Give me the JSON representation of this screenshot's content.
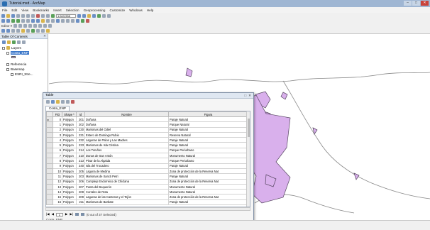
{
  "window": {
    "title": "Tutorial.mxd - ArcMap",
    "title_note": "",
    "buttons": {
      "minimize": "–",
      "maximize": "□",
      "close": "✕"
    }
  },
  "menu": [
    "File",
    "Edit",
    "View",
    "Bookmarks",
    "Insert",
    "Selection",
    "Geoprocessing",
    "Customize",
    "Windows",
    "Help"
  ],
  "toolbar": {
    "scale_value": "1:543,958",
    "editor_label": "Editor ▾"
  },
  "toc": {
    "title": "Table Of Contents",
    "close": "✕",
    "nodes": [
      {
        "label": "Layers",
        "level": 0
      },
      {
        "label": "Costa_ENP",
        "level": 1,
        "selected": true
      },
      {
        "label": "Referencia",
        "level": 1
      },
      {
        "label": "Basemap",
        "level": 1
      },
      {
        "label": "ESRI_Stre...",
        "level": 2
      }
    ]
  },
  "table_window": {
    "title": "Table",
    "controls": {
      "close": "✕",
      "pin": "□"
    },
    "tab_label": "Costa_ENP",
    "columns": [
      "FID",
      "Shape *",
      "Id",
      "Nombre",
      "Figura"
    ],
    "rows": [
      [
        "0",
        "Polygon",
        "201",
        "Doñana",
        "Paraje Natural"
      ],
      [
        "1",
        "Polygon",
        "202",
        "Doñana",
        "Parque Natural"
      ],
      [
        "2",
        "Polygon",
        "230",
        "Marismas del Odiel",
        "Paraje Natural"
      ],
      [
        "3",
        "Polygon",
        "231",
        "Estero de Domingo Rubio",
        "Reserva Natural"
      ],
      [
        "4",
        "Polygon",
        "232",
        "Lagunas de Palos y Las Madres",
        "Paraje Natural"
      ],
      [
        "5",
        "Polygon",
        "233",
        "Marismas de Isla Cristina",
        "Paraje Natural"
      ],
      [
        "6",
        "Polygon",
        "214",
        "Los Toruños",
        "Parque Periurbano"
      ],
      [
        "7",
        "Polygon",
        "210",
        "Dunas de San Antón",
        "Monumento Natural"
      ],
      [
        "8",
        "Polygon",
        "213",
        "Pinar de la Algaida",
        "Parque Periurbano"
      ],
      [
        "9",
        "Polygon",
        "240",
        "Isla del Trocadero",
        "Paraje Natural"
      ],
      [
        "10",
        "Polygon",
        "205",
        "Laguna de Medina",
        "Zona de protección de la Reserva Nat"
      ],
      [
        "11",
        "Polygon",
        "203",
        "Marismas de Sancti Petri",
        "Paraje Natural"
      ],
      [
        "12",
        "Polygon",
        "206",
        "Complejo Endorreico de Chiclana",
        "Zona de protección de la Reserva Nat"
      ],
      [
        "13",
        "Polygon",
        "207",
        "Punta del Boquerón",
        "Monumento Natural"
      ],
      [
        "14",
        "Polygon",
        "208",
        "Corrales de Rota",
        "Monumento Natural"
      ],
      [
        "15",
        "Polygon",
        "209",
        "Lagunas de las Canteras y el Tejón",
        "Zona de protección de la Reserva Nat"
      ],
      [
        "16",
        "Polygon",
        "211",
        "Marismas de Barbate",
        "Paraje Natural"
      ]
    ],
    "nav": {
      "record": "1",
      "count_text": "(0 out of 37 Selected)"
    },
    "footer": "Costa_ENP"
  }
}
